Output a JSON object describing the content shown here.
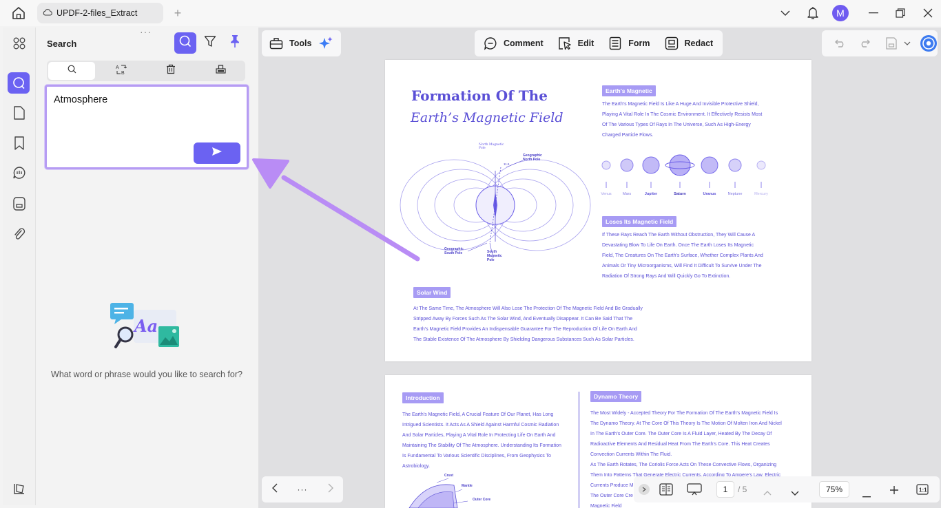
{
  "titlebar": {
    "tab_title": "UPDF-2-files_Extract",
    "avatar_letter": "M"
  },
  "panel": {
    "title": "Search",
    "search_value": "Atmosphere",
    "empty_prompt": "What word or phrase would you like to search for?"
  },
  "toolbar": {
    "tools_label": "Tools",
    "comment_label": "Comment",
    "edit_label": "Edit",
    "form_label": "Form",
    "redact_label": "Redact"
  },
  "page1": {
    "title_line1": "Formation Of The",
    "title_line2": "Earth’s Magnetic Field",
    "tag_magnetic": "Earth's Magnetic",
    "magnetic_text": [
      "The Earth's Magnetic Field Is Like A Huge And Invisible Protective Shield,",
      "Playing A Vital Role In The Cosmic Environment. It Effectively Resists Most",
      "Of The Various Types Of Rays In The Universe, Such As High-Energy",
      "Charged Particle Flows."
    ],
    "planets": [
      "Venus",
      "Mars",
      "Jupiter",
      "Saturn",
      "Uranus",
      "Neptune",
      "Mercury"
    ],
    "tag_loses": "Loses Its Magnetic Field",
    "loses_text": [
      "If These Rays Reach The Earth Without Obstruction, They Will Cause A",
      "Devastating Blow To Life On Earth. Once The Earth Loses Its Magnetic",
      "Field, The Creatures On The Earth's Surface, Whether Complex Plants And",
      "Animals Or Tiny Microorganisms, Will Find It Difficult To Survive Under The",
      "Radiation Of Strong Rays And Will Quickly Go To Extinction."
    ],
    "tag_solar": "Solar Wind",
    "solar_text": [
      "At The Same Time, The Atmosphere Will Also Lose The Protection Of The Magnetic Field And Be Gradually",
      "Stripped Away By Forces Such As The Solar Wind, And Eventually Disappear. It Can Be Said That The",
      "Earth's Magnetic Field Provides An Indispensable Guarantee For The Reproduction Of Life On Earth And",
      "The Stable Existence Of The Atmosphere By Shielding Dangerous Substances Such As Solar Particles."
    ],
    "diagram_labels": {
      "north_mag": "North Magnetic Pole",
      "geo_north": "Geographic North Pole",
      "geo_south": "Geographic South Pole",
      "south_mag": "South Magnetic Pole",
      "angle": "11.5"
    }
  },
  "page2": {
    "tag_intro": "Introduction",
    "intro_text": [
      "The Earth's Magnetic Field, A Crucial Feature Of Our Planet, Has Long",
      "Intrigued Scientists. It Acts As A Shield Against Harmful Cosmic Radiation",
      "And Solar Particles, Playing A Vital Role In Protecting Life On Earth And",
      "Maintaining The Stability Of The Atmosphere. Understanding Its Formation",
      "Is Fundamental To Various Scientific Disciplines, From Geophysics To",
      "Astrobiology."
    ],
    "tag_dynamo": "Dynamo Theory",
    "dynamo_text": [
      "The Most Widely - Accepted Theory For The Formation Of The Earth's Magnetic Field Is",
      "The Dynamo Theory. At The Core Of This Theory Is The Motion Of Molten Iron And Nickel",
      "In The Earth's Outer Core. The Outer Core Is A Fluid Layer, Heated By The Decay Of",
      "Radioactive Elements And Residual Heat From The Earth's Core. This Heat Creates",
      "Convection Currents Within The Fluid.",
      "As The Earth Rotates, The Coriolis Force Acts On These Convective Flows, Organizing",
      "Them Into Patterns That Generate Electric Currents. According To Ampere's Law, Electric",
      "Currents Produce M",
      "The Outer Core Cre",
      "Magnetic Field"
    ],
    "layer_labels": [
      "Crust",
      "Mantle",
      "Outer Core"
    ]
  },
  "bottombar": {
    "current_page": "1",
    "total_pages": "/ 5",
    "zoom": "75%",
    "more": "···"
  },
  "colors": {
    "accent": "#6b62f2",
    "doc_purple": "#5a4fd6",
    "tag_bg": "#a79bf4",
    "arrow": "#b98cf5"
  }
}
